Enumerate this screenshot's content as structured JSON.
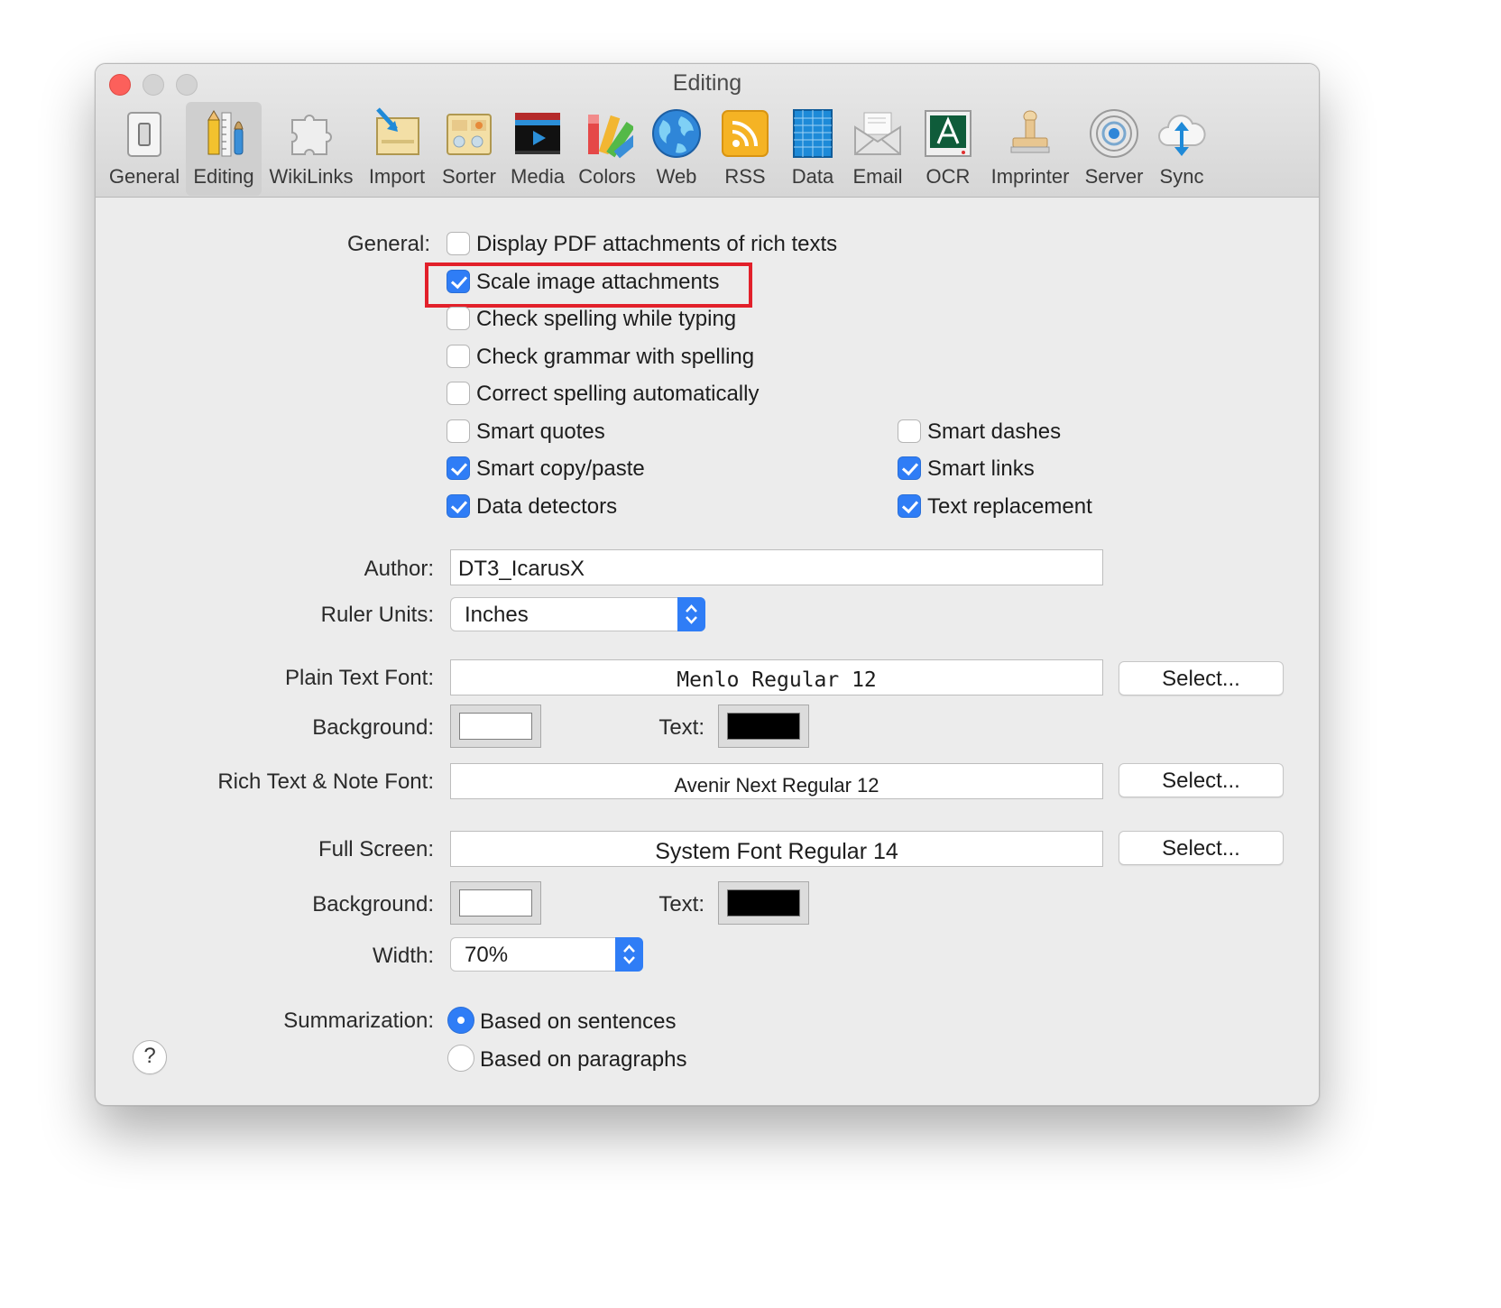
{
  "window": {
    "title": "Editing"
  },
  "toolbar": {
    "items": [
      {
        "label": "General",
        "icon": "switch-icon"
      },
      {
        "label": "Editing",
        "icon": "pencil-ruler-icon",
        "selected": true
      },
      {
        "label": "WikiLinks",
        "icon": "puzzle-icon"
      },
      {
        "label": "Import",
        "icon": "import-tray-icon"
      },
      {
        "label": "Sorter",
        "icon": "sorter-icon"
      },
      {
        "label": "Media",
        "icon": "media-player-icon"
      },
      {
        "label": "Colors",
        "icon": "color-swatches-icon"
      },
      {
        "label": "Web",
        "icon": "globe-icon"
      },
      {
        "label": "RSS",
        "icon": "rss-icon"
      },
      {
        "label": "Data",
        "icon": "data-grid-icon"
      },
      {
        "label": "Email",
        "icon": "envelope-icon"
      },
      {
        "label": "OCR",
        "icon": "ocr-icon"
      },
      {
        "label": "Imprinter",
        "icon": "stamp-icon"
      },
      {
        "label": "Server",
        "icon": "server-target-icon"
      },
      {
        "label": "Sync",
        "icon": "cloud-sync-icon"
      }
    ]
  },
  "general": {
    "label": "General:",
    "options": [
      {
        "label": "Display PDF attachments of rich texts",
        "checked": false
      },
      {
        "label": "Scale image attachments",
        "checked": true,
        "highlighted": true
      },
      {
        "label": "Check spelling while typing",
        "checked": false
      },
      {
        "label": "Check grammar with spelling",
        "checked": false
      },
      {
        "label": "Correct spelling automatically",
        "checked": false
      },
      {
        "label": "Smart quotes",
        "checked": false
      },
      {
        "label": "Smart dashes",
        "checked": false
      },
      {
        "label": "Smart copy/paste",
        "checked": true
      },
      {
        "label": "Smart links",
        "checked": true
      },
      {
        "label": "Data detectors",
        "checked": true
      },
      {
        "label": "Text replacement",
        "checked": true
      }
    ]
  },
  "author": {
    "label": "Author:",
    "value": "DT3_IcarusX"
  },
  "ruler_units": {
    "label": "Ruler Units:",
    "value": "Inches"
  },
  "plain_text_font": {
    "label": "Plain Text Font:",
    "value": "Menlo Regular 12",
    "button": "Select..."
  },
  "plain_colors": {
    "background_label": "Background:",
    "text_label": "Text:",
    "background": "#ffffff",
    "text": "#000000"
  },
  "rich_text_font": {
    "label": "Rich Text & Note Font:",
    "value": "Avenir Next Regular 12",
    "button": "Select..."
  },
  "full_screen": {
    "label": "Full Screen:",
    "value": "System Font Regular 14",
    "button": "Select..."
  },
  "full_screen_colors": {
    "background_label": "Background:",
    "text_label": "Text:",
    "background": "#ffffff",
    "text": "#000000"
  },
  "width": {
    "label": "Width:",
    "value": "70%"
  },
  "summarization": {
    "label": "Summarization:",
    "options": [
      {
        "label": "Based on sentences",
        "selected": true
      },
      {
        "label": "Based on paragraphs",
        "selected": false
      }
    ]
  },
  "help": {
    "label": "?"
  },
  "colors": {
    "accent": "#2f7df6",
    "highlight": "#e2202a",
    "close": "#fc605b"
  }
}
